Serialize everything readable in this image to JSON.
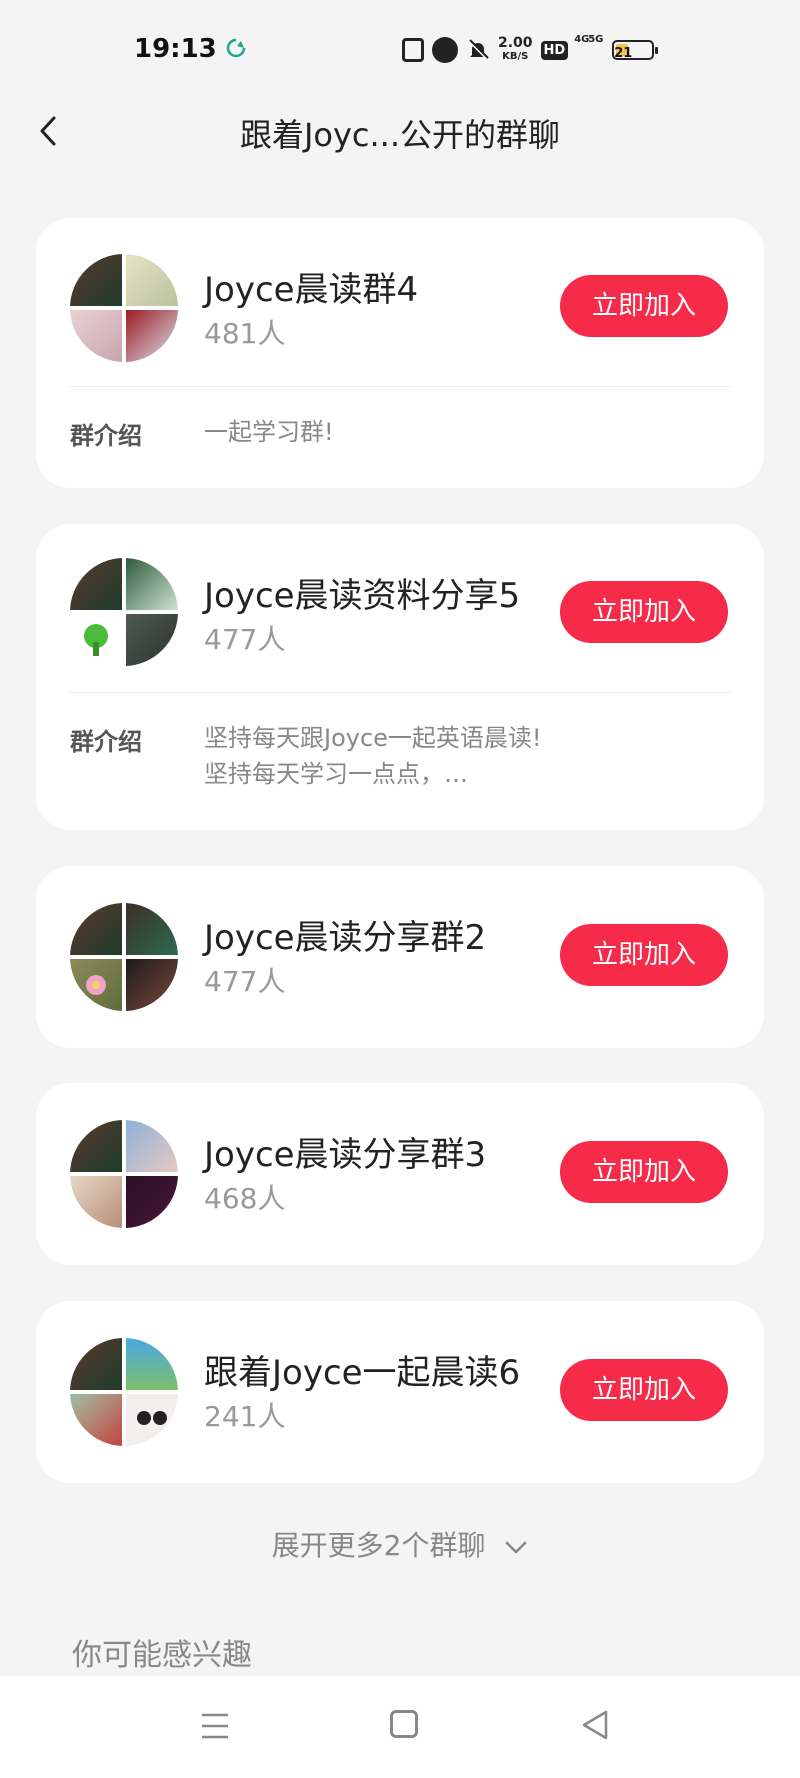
{
  "status_bar": {
    "time": "19:13",
    "speed_value": "2.00",
    "speed_unit": "KB/S",
    "hd_label": "HD",
    "net1_label": "4G",
    "net2_label": "5G",
    "battery_level": "21",
    "icons": [
      "sync-icon",
      "nfc-icon",
      "alarm-icon",
      "mute-bell-icon",
      "hd-icon",
      "signal-icon",
      "signal-icon",
      "battery-icon"
    ]
  },
  "header": {
    "title": "跟着Joyc...公开的群聊",
    "back_icon": "chevron-left-icon"
  },
  "groups": [
    {
      "name": "Joyce晨读群4",
      "count": "481人",
      "join_label": "立即加入",
      "intro_label": "群介绍",
      "intro_lines": [
        "一起学习群!"
      ]
    },
    {
      "name": "Joyce晨读资料分享5",
      "count": "477人",
      "join_label": "立即加入",
      "intro_label": "群介绍",
      "intro_lines": [
        "坚持每天跟Joyce一起英语晨读!",
        "坚持每天学习一点点，…"
      ]
    },
    {
      "name": "Joyce晨读分享群2",
      "count": "477人",
      "join_label": "立即加入"
    },
    {
      "name": "Joyce晨读分享群3",
      "count": "468人",
      "join_label": "立即加入"
    },
    {
      "name": "跟着Joyce一起晨读6",
      "count": "241人",
      "join_label": "立即加入"
    }
  ],
  "more": {
    "label": "展开更多2个群聊",
    "icon": "chevron-down-icon"
  },
  "section": {
    "title": "你可能感兴趣"
  },
  "nav": {
    "icons": [
      "menu-icon",
      "home-square-icon",
      "back-triangle-icon"
    ]
  },
  "colors": {
    "accent": "#f62a49",
    "background": "#f4f4f4",
    "card": "#ffffff",
    "muted_text": "#999999"
  }
}
